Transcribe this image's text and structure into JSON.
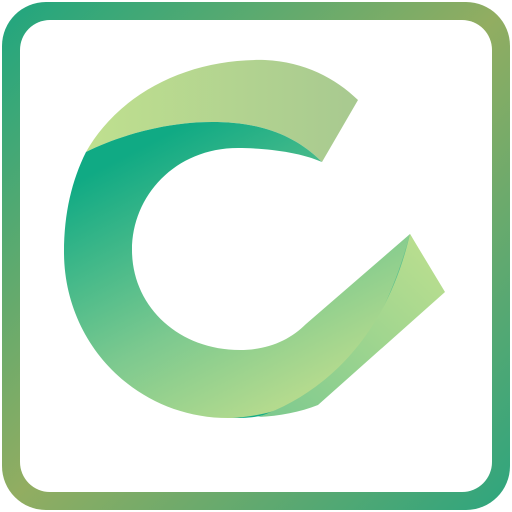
{
  "app_icon": {
    "icon_name": "ribbon-letter-c-icon",
    "colors": {
      "frame_start": "#1fa67f",
      "frame_mid": "#92ad61",
      "frame_end": "#2ea57e",
      "background": "#ffffff",
      "ribbon_light": "#c3df8d",
      "ribbon_mid": "#7cc98f",
      "ribbon_dark": "#10aa84",
      "ribbon_tail": "#bfe08f"
    }
  }
}
